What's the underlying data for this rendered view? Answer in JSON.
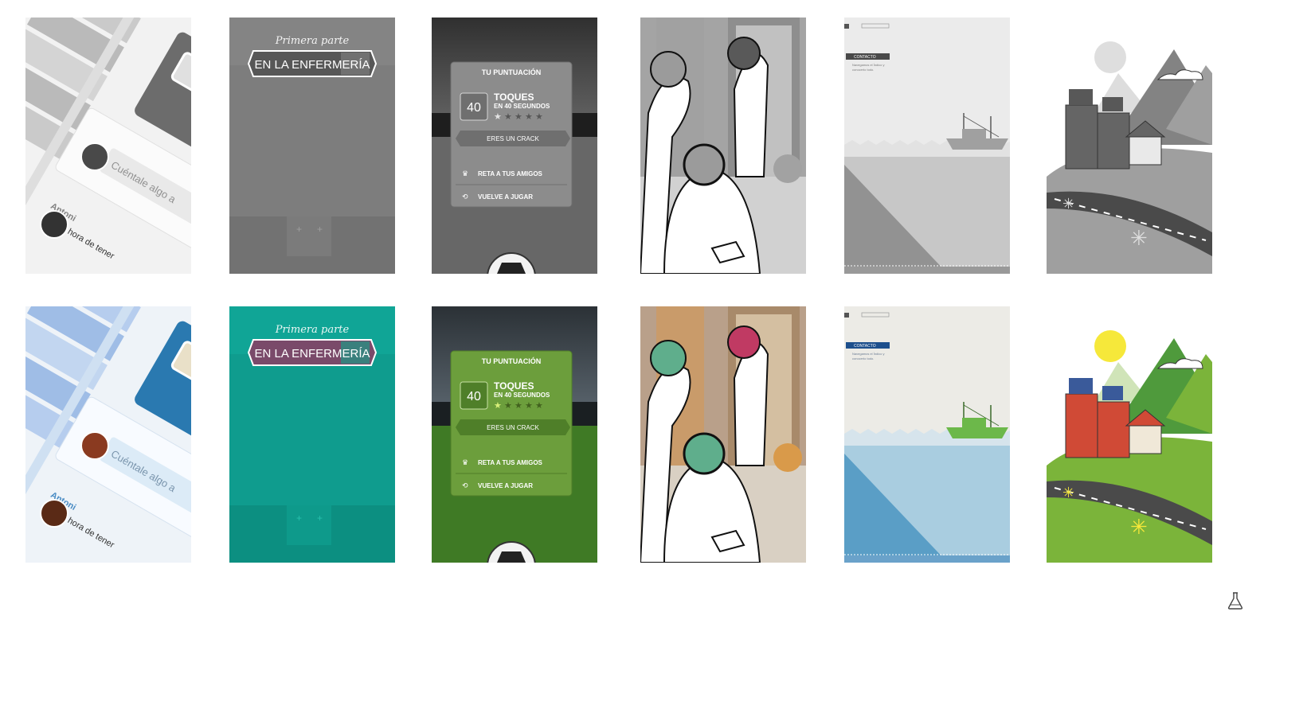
{
  "rows": [
    {
      "variant": "grayscale"
    },
    {
      "variant": "color"
    }
  ],
  "columns": [
    {
      "id": "social",
      "name_1": "Antoni",
      "status_1": "Ya era hora de tener",
      "prompt": "Cuéntale algo a",
      "colors": {
        "accent": "#2a79b0",
        "light": "#9fbde6",
        "bg": "#eef3f8"
      }
    },
    {
      "id": "enfermeria",
      "subtitle": "Primera parte",
      "banner": "EN LA ENFERMERÍA",
      "colors": {
        "bg": "#10a596",
        "banner": "#7a4a6a",
        "bar": "#0c8f81"
      }
    },
    {
      "id": "score",
      "header": "TU PUNTUACIÓN",
      "score": "40",
      "touches": "TOQUES",
      "seconds_prefix": "EN",
      "seconds_value": "40",
      "seconds_suffix": "SEGUNDOS",
      "ribbon": "ERES UN CRACK",
      "challenge": "RETA A TUS AMIGOS",
      "replay": "VUELVE A JUGAR",
      "stars": {
        "filled": 1,
        "total": 5
      },
      "colors": {
        "panel": "#6c9e3c",
        "field": "#3f7a25"
      }
    },
    {
      "id": "sketch",
      "colors": {
        "face_a": "#5fae8c",
        "face_b": "#c03a63"
      }
    },
    {
      "id": "boat",
      "menu_item": "CONTACTO",
      "text_line_1": "Navegamos el Índico y",
      "text_line_2": "conocerlo todo.",
      "colors": {
        "sea": "#a9cde0",
        "deep": "#5a9ec6",
        "boat": "#6cb84a"
      }
    },
    {
      "id": "village",
      "colors": {
        "sun": "#f6e83a",
        "hill": "#7bb43a",
        "house": "#d04a36"
      }
    }
  ],
  "icons": {
    "flask": "flask-icon"
  }
}
